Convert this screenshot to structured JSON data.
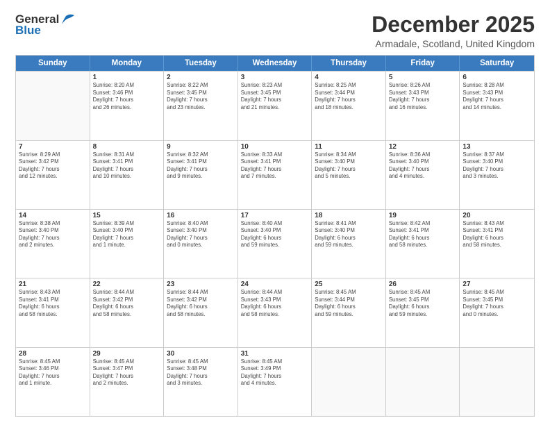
{
  "logo": {
    "line1": "General",
    "line2": "Blue"
  },
  "title": "December 2025",
  "location": "Armadale, Scotland, United Kingdom",
  "weekdays": [
    "Sunday",
    "Monday",
    "Tuesday",
    "Wednesday",
    "Thursday",
    "Friday",
    "Saturday"
  ],
  "rows": [
    [
      {
        "day": "",
        "info": ""
      },
      {
        "day": "1",
        "info": "Sunrise: 8:20 AM\nSunset: 3:46 PM\nDaylight: 7 hours\nand 26 minutes."
      },
      {
        "day": "2",
        "info": "Sunrise: 8:22 AM\nSunset: 3:45 PM\nDaylight: 7 hours\nand 23 minutes."
      },
      {
        "day": "3",
        "info": "Sunrise: 8:23 AM\nSunset: 3:45 PM\nDaylight: 7 hours\nand 21 minutes."
      },
      {
        "day": "4",
        "info": "Sunrise: 8:25 AM\nSunset: 3:44 PM\nDaylight: 7 hours\nand 18 minutes."
      },
      {
        "day": "5",
        "info": "Sunrise: 8:26 AM\nSunset: 3:43 PM\nDaylight: 7 hours\nand 16 minutes."
      },
      {
        "day": "6",
        "info": "Sunrise: 8:28 AM\nSunset: 3:43 PM\nDaylight: 7 hours\nand 14 minutes."
      }
    ],
    [
      {
        "day": "7",
        "info": "Sunrise: 8:29 AM\nSunset: 3:42 PM\nDaylight: 7 hours\nand 12 minutes."
      },
      {
        "day": "8",
        "info": "Sunrise: 8:31 AM\nSunset: 3:41 PM\nDaylight: 7 hours\nand 10 minutes."
      },
      {
        "day": "9",
        "info": "Sunrise: 8:32 AM\nSunset: 3:41 PM\nDaylight: 7 hours\nand 9 minutes."
      },
      {
        "day": "10",
        "info": "Sunrise: 8:33 AM\nSunset: 3:41 PM\nDaylight: 7 hours\nand 7 minutes."
      },
      {
        "day": "11",
        "info": "Sunrise: 8:34 AM\nSunset: 3:40 PM\nDaylight: 7 hours\nand 5 minutes."
      },
      {
        "day": "12",
        "info": "Sunrise: 8:36 AM\nSunset: 3:40 PM\nDaylight: 7 hours\nand 4 minutes."
      },
      {
        "day": "13",
        "info": "Sunrise: 8:37 AM\nSunset: 3:40 PM\nDaylight: 7 hours\nand 3 minutes."
      }
    ],
    [
      {
        "day": "14",
        "info": "Sunrise: 8:38 AM\nSunset: 3:40 PM\nDaylight: 7 hours\nand 2 minutes."
      },
      {
        "day": "15",
        "info": "Sunrise: 8:39 AM\nSunset: 3:40 PM\nDaylight: 7 hours\nand 1 minute."
      },
      {
        "day": "16",
        "info": "Sunrise: 8:40 AM\nSunset: 3:40 PM\nDaylight: 7 hours\nand 0 minutes."
      },
      {
        "day": "17",
        "info": "Sunrise: 8:40 AM\nSunset: 3:40 PM\nDaylight: 6 hours\nand 59 minutes."
      },
      {
        "day": "18",
        "info": "Sunrise: 8:41 AM\nSunset: 3:40 PM\nDaylight: 6 hours\nand 59 minutes."
      },
      {
        "day": "19",
        "info": "Sunrise: 8:42 AM\nSunset: 3:41 PM\nDaylight: 6 hours\nand 58 minutes."
      },
      {
        "day": "20",
        "info": "Sunrise: 8:43 AM\nSunset: 3:41 PM\nDaylight: 6 hours\nand 58 minutes."
      }
    ],
    [
      {
        "day": "21",
        "info": "Sunrise: 8:43 AM\nSunset: 3:41 PM\nDaylight: 6 hours\nand 58 minutes."
      },
      {
        "day": "22",
        "info": "Sunrise: 8:44 AM\nSunset: 3:42 PM\nDaylight: 6 hours\nand 58 minutes."
      },
      {
        "day": "23",
        "info": "Sunrise: 8:44 AM\nSunset: 3:42 PM\nDaylight: 6 hours\nand 58 minutes."
      },
      {
        "day": "24",
        "info": "Sunrise: 8:44 AM\nSunset: 3:43 PM\nDaylight: 6 hours\nand 58 minutes."
      },
      {
        "day": "25",
        "info": "Sunrise: 8:45 AM\nSunset: 3:44 PM\nDaylight: 6 hours\nand 59 minutes."
      },
      {
        "day": "26",
        "info": "Sunrise: 8:45 AM\nSunset: 3:45 PM\nDaylight: 6 hours\nand 59 minutes."
      },
      {
        "day": "27",
        "info": "Sunrise: 8:45 AM\nSunset: 3:45 PM\nDaylight: 7 hours\nand 0 minutes."
      }
    ],
    [
      {
        "day": "28",
        "info": "Sunrise: 8:45 AM\nSunset: 3:46 PM\nDaylight: 7 hours\nand 1 minute."
      },
      {
        "day": "29",
        "info": "Sunrise: 8:45 AM\nSunset: 3:47 PM\nDaylight: 7 hours\nand 2 minutes."
      },
      {
        "day": "30",
        "info": "Sunrise: 8:45 AM\nSunset: 3:48 PM\nDaylight: 7 hours\nand 3 minutes."
      },
      {
        "day": "31",
        "info": "Sunrise: 8:45 AM\nSunset: 3:49 PM\nDaylight: 7 hours\nand 4 minutes."
      },
      {
        "day": "",
        "info": ""
      },
      {
        "day": "",
        "info": ""
      },
      {
        "day": "",
        "info": ""
      }
    ]
  ]
}
